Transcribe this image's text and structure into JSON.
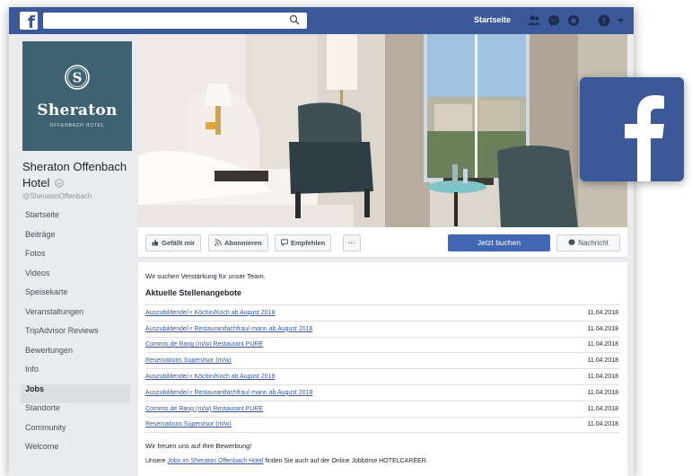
{
  "topbar": {
    "home_label": "Startseite",
    "icons": [
      "facebook-logo-icon",
      "search-icon",
      "friend-requests-icon",
      "messenger-icon",
      "notifications-icon",
      "help-icon",
      "chevron-down-icon"
    ]
  },
  "profile": {
    "logo_name": "Sheraton",
    "logo_subline": "OFFENBACH HOTEL",
    "page_name": "Sheraton Offenbach Hotel",
    "handle": "@SheratonOffenbach"
  },
  "nav": {
    "items": [
      {
        "label": "Startseite"
      },
      {
        "label": "Beiträge"
      },
      {
        "label": "Fotos"
      },
      {
        "label": "Videos"
      },
      {
        "label": "Speisekarte"
      },
      {
        "label": "Veranstaltungen"
      },
      {
        "label": "TripAdvisor Reviews"
      },
      {
        "label": "Bewertungen"
      },
      {
        "label": "Info"
      },
      {
        "label": "Jobs"
      },
      {
        "label": "Standorte"
      },
      {
        "label": "Community"
      },
      {
        "label": "Welcome"
      }
    ],
    "active": "Jobs"
  },
  "actions": {
    "like_label": "Gefällt mir",
    "follow_label": "Abonnieren",
    "recommend_label": "Empfehlen",
    "more_label": "···",
    "book_label": "Jetzt buchen",
    "message_label": "Nachricht"
  },
  "content": {
    "intro": "Wir suchen Verstärkung für unser Team.",
    "section_title": "Aktuelle Stellenangebote",
    "jobs": [
      {
        "title": "Auszubildende/-r Köchin/Koch ab August 2018",
        "date": "11.04.2018"
      },
      {
        "title": "Auszubildende/-r Restaurantfachfrau/-mann ab August 2018",
        "date": "11.04.2018"
      },
      {
        "title": "Commis de Rang (m/w) Restaurant PURE",
        "date": "11.04.2018"
      },
      {
        "title": "Reservations Supervisor (m/w)",
        "date": "11.04.2018"
      },
      {
        "title": "Auszubildende/-r Köchin/Koch ab August 2018",
        "date": "11.04.2018"
      },
      {
        "title": "Auszubildende/-r Restaurantfachfrau/-mann ab August 2018",
        "date": "11.04.2018"
      },
      {
        "title": "Commis de Rang (m/w) Restaurant PURE",
        "date": "11.04.2018"
      },
      {
        "title": "Reservations Supervisor (m/w)",
        "date": "11.04.2018"
      }
    ],
    "outro": "Wir freuen uns auf Ihre Bewerbung!",
    "outro2_prefix": "Unsere",
    "outro2_link": "Jobs im Sheraton Offenbach Hotel",
    "outro2_suffix": "finden Sie auch auf der Online Jobbörse HOTELCAREER."
  },
  "colors": {
    "facebook_blue": "#3b5998",
    "primary_button": "#4267b2",
    "logo_background": "#3f6273",
    "link": "#365899"
  }
}
